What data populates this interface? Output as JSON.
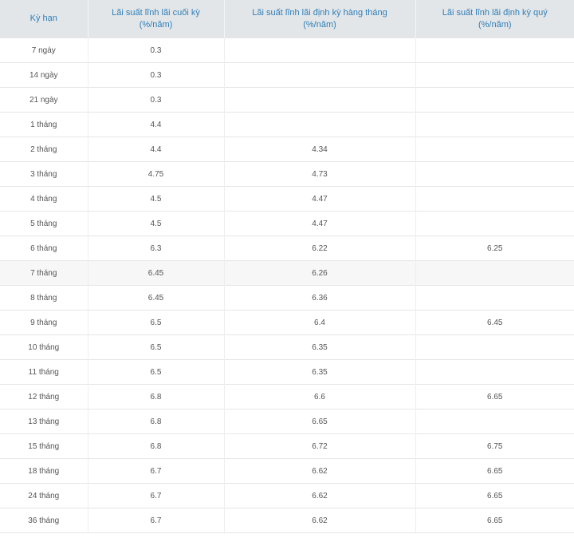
{
  "table": {
    "headers": [
      {
        "line1": "Kỳ hạn",
        "line2": ""
      },
      {
        "line1": "Lãi suất lĩnh lãi cuối kỳ",
        "line2": "(%/năm)"
      },
      {
        "line1": "Lãi suất lĩnh lãi định kỳ hàng tháng",
        "line2": "(%/năm)"
      },
      {
        "line1": "Lãi suất lĩnh lãi định kỳ quý",
        "line2": "(%/năm)"
      }
    ],
    "rows": [
      [
        "7 ngày",
        "0.3",
        "",
        ""
      ],
      [
        "14 ngày",
        "0.3",
        "",
        ""
      ],
      [
        "21 ngày",
        "0.3",
        "",
        ""
      ],
      [
        "1 tháng",
        "4.4",
        "",
        ""
      ],
      [
        "2 tháng",
        "4.4",
        "4.34",
        ""
      ],
      [
        "3 tháng",
        "4.75",
        "4.73",
        ""
      ],
      [
        "4 tháng",
        "4.5",
        "4.47",
        ""
      ],
      [
        "5 tháng",
        "4.5",
        "4.47",
        ""
      ],
      [
        "6 tháng",
        "6.3",
        "6.22",
        "6.25"
      ],
      [
        "7 tháng",
        "6.45",
        "6.26",
        ""
      ],
      [
        "8 tháng",
        "6.45",
        "6.36",
        ""
      ],
      [
        "9 tháng",
        "6.5",
        "6.4",
        "6.45"
      ],
      [
        "10 tháng",
        "6.5",
        "6.35",
        ""
      ],
      [
        "11 tháng",
        "6.5",
        "6.35",
        ""
      ],
      [
        "12 tháng",
        "6.8",
        "6.6",
        "6.65"
      ],
      [
        "13 tháng",
        "6.8",
        "6.65",
        ""
      ],
      [
        "15 tháng",
        "6.8",
        "6.72",
        "6.75"
      ],
      [
        "18 tháng",
        "6.7",
        "6.62",
        "6.65"
      ],
      [
        "24 tháng",
        "6.7",
        "6.62",
        "6.65"
      ],
      [
        "36 tháng",
        "6.7",
        "6.62",
        "6.65"
      ]
    ]
  },
  "colors": {
    "header_bg": "#e3e6e9",
    "header_text": "#2f7fb8",
    "cell_text": "#555555",
    "band_bg": "#f7f7f7"
  }
}
